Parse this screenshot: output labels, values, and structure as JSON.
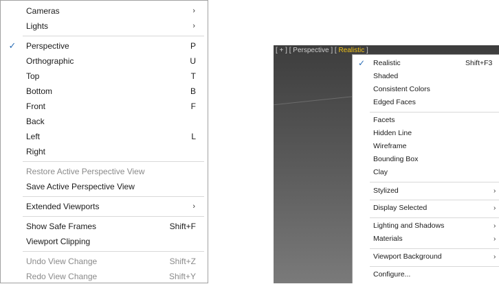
{
  "left_menu": {
    "cameras": "Cameras",
    "lights": "Lights",
    "perspective": "Perspective",
    "perspective_sc": "P",
    "orthographic": "Orthographic",
    "orthographic_sc": "U",
    "top": "Top",
    "top_sc": "T",
    "bottom": "Bottom",
    "bottom_sc": "B",
    "front": "Front",
    "front_sc": "F",
    "back": "Back",
    "left": "Left",
    "left_sc": "L",
    "right": "Right",
    "restore": "Restore Active Perspective View",
    "save": "Save Active Perspective View",
    "extended": "Extended Viewports",
    "safe_frames": "Show Safe Frames",
    "safe_frames_sc": "Shift+F",
    "clipping": "Viewport Clipping",
    "undo": "Undo View Change",
    "undo_sc": "Shift+Z",
    "redo": "Redo View Change",
    "redo_sc": "Shift+Y",
    "checkmark": "✓",
    "arrow": "›"
  },
  "viewport": {
    "label_prefix": "[ + ] [ Perspective ] [ ",
    "label_active": "Realistic",
    "label_suffix": " ]"
  },
  "right_menu": {
    "realistic": "Realistic",
    "realistic_sc": "Shift+F3",
    "shaded": "Shaded",
    "consistent": "Consistent Colors",
    "edged": "Edged Faces",
    "facets": "Facets",
    "hidden": "Hidden Line",
    "wireframe": "Wireframe",
    "bbox": "Bounding Box",
    "clay": "Clay",
    "stylized": "Stylized",
    "display_selected": "Display Selected",
    "lighting": "Lighting and Shadows",
    "materials": "Materials",
    "vp_background": "Viewport Background",
    "configure": "Configure...",
    "checkmark": "✓",
    "arrow": "›"
  },
  "colors": {
    "active_label": "#f2c318",
    "checkmark": "#2a6db5"
  }
}
